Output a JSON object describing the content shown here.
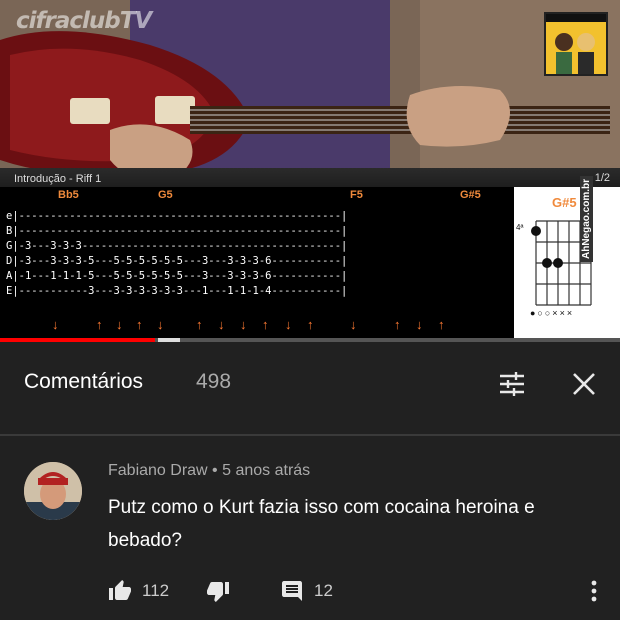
{
  "video": {
    "logo_text": "cifraclubTV",
    "riff_label": "Introdução - Riff 1",
    "page_indicator": "1/2",
    "tab_headers": [
      "Bb5",
      "G5",
      "F5",
      "G#5"
    ],
    "tab_lines": [
      "e|---------------------------------------------------|",
      "B|---------------------------------------------------|",
      "G|-3---3-3-3-----------------------------------------|",
      "D|-3---3-3-3-5---5-5-5-5-5-5---3---3-3-3-6-----------|",
      "A|-1---1-1-1-5---5-5-5-5-5-5---3---3-3-3-6-----------|",
      "E|-----------3---3-3-3-3-3-3---1---1-1-1-4-----------|"
    ],
    "strum_arrows": [
      "↓",
      "↑",
      "↓",
      "↑",
      "↓",
      "↑",
      "↓",
      "↓",
      "↑",
      "↓",
      "↑",
      "↓",
      "↑",
      "↓",
      "↑"
    ],
    "chord_name": "G#5",
    "chord_fret": "4ª",
    "chord_string_marks": "●○○×××",
    "watermark": "AhNegao.com.br",
    "progress_fraction": 0.25
  },
  "comments": {
    "title": "Comentários",
    "count": "498"
  },
  "comment": {
    "author": "Fabiano Draw",
    "separator": " • ",
    "time": "5 anos atrás",
    "text": "Putz como o Kurt fazia isso com cocaina heroina e bebado?",
    "likes": "112",
    "replies": "12"
  },
  "colors": {
    "background": "#212121",
    "accent_orange": "#f08a3c",
    "progress_red": "#ff0000",
    "text_secondary": "#aaaaaa"
  },
  "icons": {
    "sort": "sort-filter-icon",
    "close": "close-icon",
    "like": "thumbs-up-icon",
    "dislike": "thumbs-down-icon",
    "reply": "comment-icon",
    "more": "more-vert-icon"
  }
}
